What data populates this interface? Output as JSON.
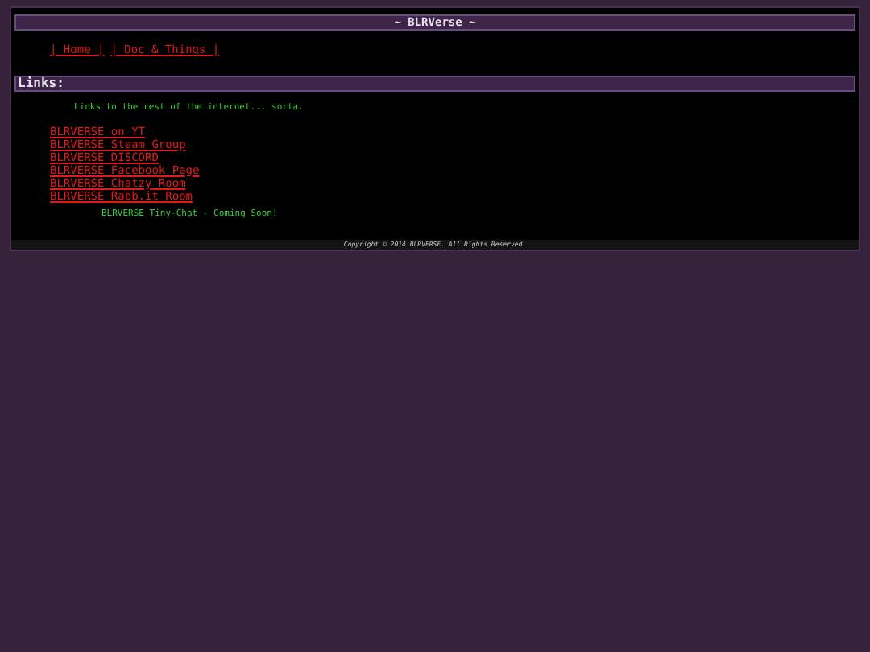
{
  "header": {
    "title": "~ BLRVerse ~"
  },
  "nav": [
    "| Home |",
    "| Doc & Things |"
  ],
  "section": {
    "heading": "Links:",
    "intro": "Links to the rest of the internet... sorta."
  },
  "links": [
    "BLRVERSE on YT",
    "BLRVERSE Steam Group",
    "BLRVERSE DISCORD",
    "BLRVERSE Facebook Page",
    "BLRVERSE Chatzy Room",
    "BLRVERSE Rabb.it Room"
  ],
  "notice": "BLRVERSE Tiny-Chat - Coming Soon!",
  "footer": "Copyright © 2014 BLRVERSE. All Rights Reserved."
}
